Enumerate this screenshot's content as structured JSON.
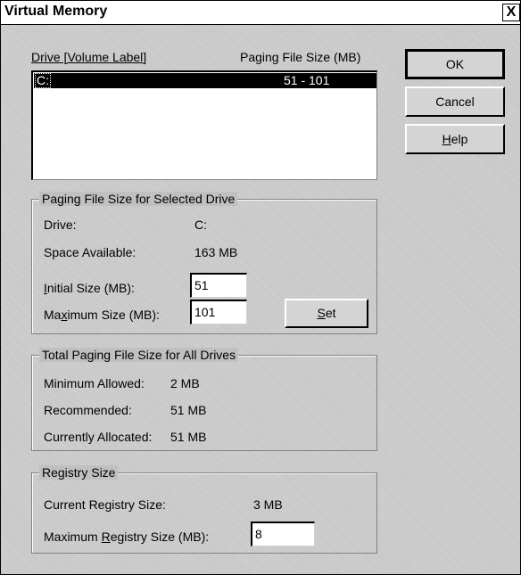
{
  "window": {
    "title": "Virtual Memory",
    "close": "X"
  },
  "list": {
    "col_drive": "Drive  [Volume Label]",
    "col_size": "Paging File Size (MB)",
    "rows": [
      {
        "drive": "C:",
        "size": "51 - 101"
      }
    ]
  },
  "buttons": {
    "ok": "OK",
    "cancel": "Cancel",
    "help_pre": "",
    "help_ul": "H",
    "help_post": "elp",
    "set_ul": "S",
    "set_post": "et"
  },
  "selected": {
    "title": "Paging File Size for Selected Drive",
    "drive_label": "Drive:",
    "drive_value": "C:",
    "space_label": "Space Available:",
    "space_value": "163 MB",
    "initial_ul": "I",
    "initial_rest": "nitial Size (MB):",
    "initial_value": "51",
    "max_pre": "Ma",
    "max_ul": "x",
    "max_rest": "imum Size (MB):",
    "max_value": "101"
  },
  "total": {
    "title": "Total Paging File Size for All Drives",
    "min_label": "Minimum Allowed:",
    "min_value": "2 MB",
    "rec_label": "Recommended:",
    "rec_value": "51 MB",
    "cur_label": "Currently Allocated:",
    "cur_value": "51 MB"
  },
  "registry": {
    "title": "Registry Size",
    "current_label": "Current Registry Size:",
    "current_value": "3 MB",
    "max_pre": "Maximum ",
    "max_ul": "R",
    "max_rest": "egistry Size (MB):",
    "max_value": "8"
  }
}
